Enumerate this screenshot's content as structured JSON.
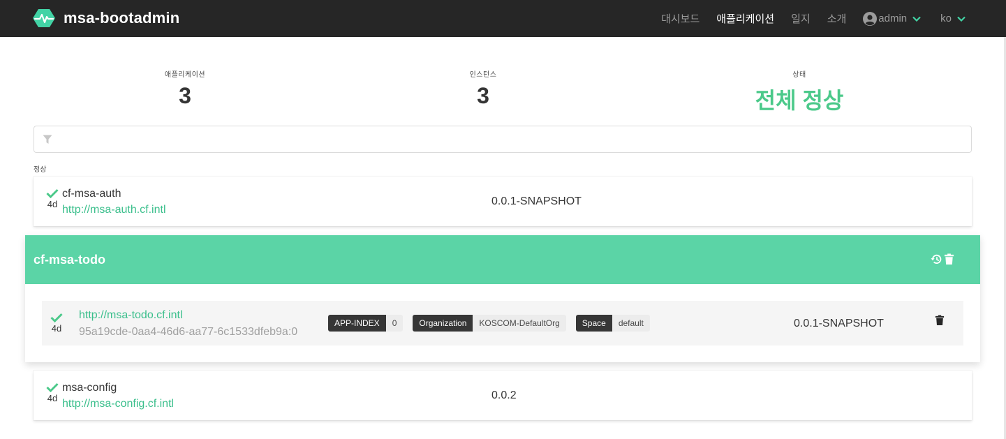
{
  "navbar": {
    "brand": "msa-bootadmin",
    "items": [
      {
        "label": "대시보드"
      },
      {
        "label": "애플리케이션"
      },
      {
        "label": "일지"
      },
      {
        "label": "소개"
      }
    ],
    "user": "admin",
    "lang": "ko"
  },
  "stats": {
    "applications": {
      "heading": "애플리케이션",
      "value": "3"
    },
    "instances": {
      "heading": "인스턴스",
      "value": "3"
    },
    "status": {
      "heading": "상태",
      "value": "전체 정상"
    }
  },
  "filter": {
    "placeholder": "",
    "value": ""
  },
  "group_label": "정상",
  "apps": [
    {
      "name": "cf-msa-auth",
      "url": "http://msa-auth.cf.intl",
      "version": "0.0.1-SNAPSHOT",
      "age": "4d"
    },
    {
      "name": "msa-config",
      "url": "http://msa-config.cf.intl",
      "version": "0.0.2",
      "age": "4d"
    }
  ],
  "expanded_app": {
    "name": "cf-msa-todo",
    "instance": {
      "url": "http://msa-todo.cf.intl",
      "id": "95a19cde-0aa4-46d6-aa77-6c1533dfeb9a:0",
      "age": "4d",
      "tags": [
        {
          "key": "APP-INDEX",
          "value": "0"
        },
        {
          "key": "Organization",
          "value": "KOSCOM-DefaultOrg"
        },
        {
          "key": "Space",
          "value": "default"
        }
      ],
      "version": "0.0.1-SNAPSHOT"
    }
  },
  "colors": {
    "accent": "#5bd4a6",
    "link": "#3bbf8c",
    "navbar": "#262626"
  },
  "icons": [
    "heartbeat-logo-icon",
    "user-circle-icon",
    "chevron-down-icon",
    "filter-icon",
    "check-icon",
    "history-icon",
    "trash-icon"
  ]
}
